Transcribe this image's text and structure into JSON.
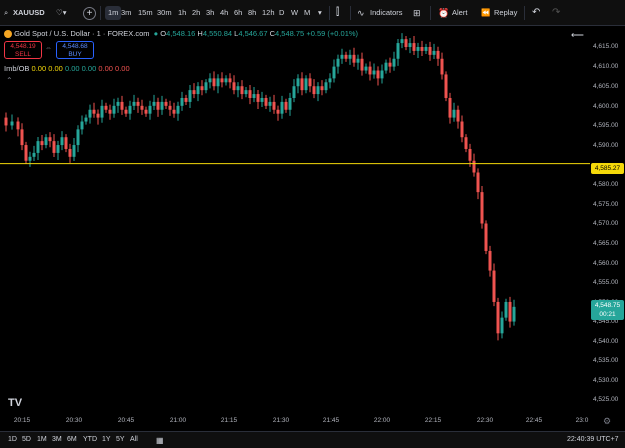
{
  "toolbar": {
    "symbol": "XAUUSD",
    "timeframes": [
      "1m",
      "3m",
      "15m",
      "30m",
      "1h",
      "2h",
      "3h",
      "4h",
      "6h",
      "8h",
      "12h",
      "D",
      "W",
      "M"
    ],
    "active_timeframe": "1m",
    "indicators_label": "Indicators",
    "alert_label": "Alert",
    "replay_label": "Replay"
  },
  "legend": {
    "title": "Gold Spot / U.S. Dollar · 1 · FOREX.com",
    "o_label": "O",
    "o_value": "4,548.16",
    "h_label": "H",
    "h_value": "4,550.84",
    "l_label": "L",
    "l_value": "4,546.67",
    "c_label": "C",
    "c_value": "4,548.75",
    "change": "+0.59 (+0.01%)",
    "sell_price": "4,548.19",
    "sell_label": "SELL",
    "buy_price": "4,548.68",
    "buy_label": "BUY",
    "indicator_name": "Imb/OB",
    "indicator_values": [
      "0.00",
      "0.00",
      "0.00",
      "0.00",
      "0.00",
      "0.00"
    ]
  },
  "price_axis": {
    "labels": [
      "4,615.00",
      "4,610.00",
      "4,605.00",
      "4,600.00",
      "4,595.00",
      "4,590.00",
      "4,580.00",
      "4,575.00",
      "4,570.00",
      "4,565.00",
      "4,560.00",
      "4,555.00",
      "4,550.00",
      "4,545.00",
      "4,540.00",
      "4,535.00",
      "4,530.00",
      "4,525.00"
    ],
    "line_price_tag": "4,585.27",
    "current_price_tag": "4,548.75",
    "countdown": "00:21"
  },
  "time_axis": {
    "labels": [
      "20:15",
      "20:30",
      "20:45",
      "21:00",
      "21:15",
      "21:30",
      "21:45",
      "22:00",
      "22:15",
      "22:30",
      "22:45",
      "23:0"
    ]
  },
  "bottom_bar": {
    "ranges": [
      "1D",
      "5D",
      "1M",
      "3M",
      "6M",
      "YTD",
      "1Y",
      "5Y",
      "All"
    ],
    "clock": "22:40:39 UTC+7"
  },
  "colors": {
    "up": "#26a69a",
    "down": "#ef5350",
    "hline": "#f5d90a",
    "accent": "#2962ff"
  },
  "chart_data": {
    "type": "candlestick",
    "horizontal_line": 4585.27,
    "ylim": [
      4524,
      4618
    ],
    "close_path": [
      [
        0,
        4597
      ],
      [
        6,
        4595
      ],
      [
        12,
        4596
      ],
      [
        18,
        4594
      ],
      [
        22,
        4590
      ],
      [
        26,
        4586
      ],
      [
        30,
        4587
      ],
      [
        34,
        4588
      ],
      [
        38,
        4591
      ],
      [
        42,
        4590
      ],
      [
        46,
        4592
      ],
      [
        50,
        4591
      ],
      [
        54,
        4588
      ],
      [
        58,
        4590
      ],
      [
        62,
        4592
      ],
      [
        66,
        4589
      ],
      [
        70,
        4587
      ],
      [
        74,
        4590
      ],
      [
        78,
        4594
      ],
      [
        82,
        4596
      ],
      [
        86,
        4597
      ],
      [
        90,
        4599
      ],
      [
        94,
        4598
      ],
      [
        98,
        4597
      ],
      [
        102,
        4600
      ],
      [
        106,
        4599
      ],
      [
        110,
        4598
      ],
      [
        114,
        4600
      ],
      [
        118,
        4601
      ],
      [
        122,
        4599
      ],
      [
        126,
        4598
      ],
      [
        130,
        4600
      ],
      [
        134,
        4601
      ],
      [
        138,
        4600
      ],
      [
        142,
        4599
      ],
      [
        146,
        4598
      ],
      [
        150,
        4600
      ],
      [
        154,
        4601
      ],
      [
        158,
        4599
      ],
      [
        162,
        4601
      ],
      [
        166,
        4600
      ],
      [
        170,
        4599
      ],
      [
        174,
        4598
      ],
      [
        178,
        4600
      ],
      [
        182,
        4602
      ],
      [
        186,
        4601
      ],
      [
        190,
        4604
      ],
      [
        194,
        4603
      ],
      [
        198,
        4605
      ],
      [
        202,
        4604
      ],
      [
        206,
        4606
      ],
      [
        210,
        4607
      ],
      [
        214,
        4605
      ],
      [
        218,
        4607
      ],
      [
        222,
        4606
      ],
      [
        226,
        4607
      ],
      [
        230,
        4606
      ],
      [
        234,
        4604
      ],
      [
        238,
        4605
      ],
      [
        242,
        4603
      ],
      [
        246,
        4604
      ],
      [
        250,
        4602
      ],
      [
        254,
        4603
      ],
      [
        258,
        4601
      ],
      [
        262,
        4602
      ],
      [
        266,
        4600
      ],
      [
        270,
        4601
      ],
      [
        274,
        4599
      ],
      [
        278,
        4598
      ],
      [
        282,
        4601
      ],
      [
        286,
        4599
      ],
      [
        290,
        4602
      ],
      [
        294,
        4605
      ],
      [
        298,
        4607
      ],
      [
        302,
        4604
      ],
      [
        306,
        4607
      ],
      [
        310,
        4605
      ],
      [
        314,
        4603
      ],
      [
        318,
        4605
      ],
      [
        322,
        4604
      ],
      [
        326,
        4606
      ],
      [
        330,
        4607
      ],
      [
        334,
        4610
      ],
      [
        338,
        4612
      ],
      [
        342,
        4613
      ],
      [
        346,
        4612
      ],
      [
        350,
        4613
      ],
      [
        354,
        4611
      ],
      [
        358,
        4612
      ],
      [
        362,
        4609
      ],
      [
        366,
        4610
      ],
      [
        370,
        4608
      ],
      [
        374,
        4609
      ],
      [
        378,
        4607
      ],
      [
        382,
        4609
      ],
      [
        386,
        4611
      ],
      [
        390,
        4610
      ],
      [
        394,
        4612
      ],
      [
        398,
        4616
      ],
      [
        402,
        4617
      ],
      [
        406,
        4615
      ],
      [
        410,
        4616
      ],
      [
        414,
        4614
      ],
      [
        418,
        4615
      ],
      [
        422,
        4614
      ],
      [
        426,
        4615
      ],
      [
        430,
        4613
      ],
      [
        434,
        4614
      ],
      [
        438,
        4612
      ],
      [
        442,
        4608
      ],
      [
        446,
        4602
      ],
      [
        450,
        4597
      ],
      [
        454,
        4599
      ],
      [
        458,
        4596
      ],
      [
        462,
        4592
      ],
      [
        466,
        4589
      ],
      [
        470,
        4586
      ],
      [
        474,
        4583
      ],
      [
        478,
        4578
      ],
      [
        482,
        4570
      ],
      [
        486,
        4563
      ],
      [
        490,
        4558
      ],
      [
        494,
        4550
      ],
      [
        498,
        4542
      ],
      [
        502,
        4546
      ],
      [
        506,
        4550
      ],
      [
        510,
        4545
      ],
      [
        514,
        4548.75
      ]
    ]
  }
}
